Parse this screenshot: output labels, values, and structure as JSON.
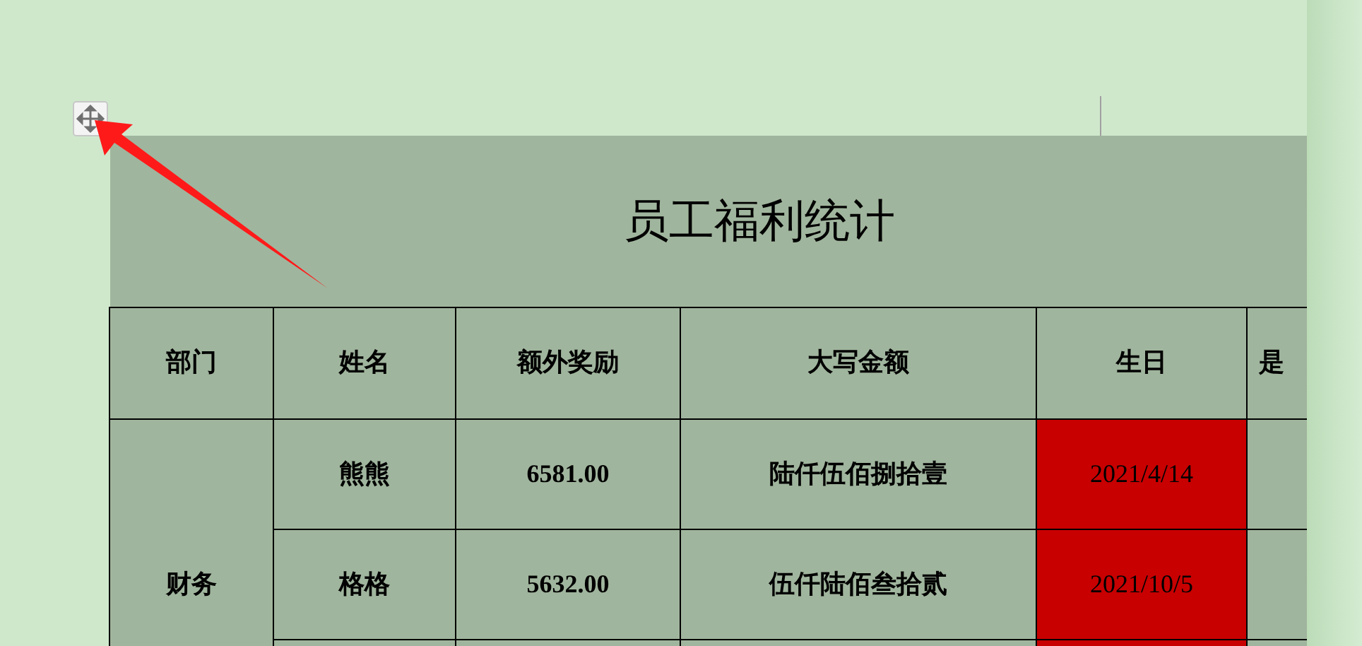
{
  "table": {
    "title": "员工福利统计",
    "columns": [
      "部门",
      "姓名",
      "额外奖励",
      "大写金额",
      "生日",
      "是"
    ],
    "groups": [
      {
        "department": "财务",
        "rows": [
          {
            "name": "熊熊",
            "bonus": "6581.00",
            "amount_in_words": "陆仟伍佰捌拾壹",
            "birthday": "2021/4/14",
            "highlighted": true
          },
          {
            "name": "格格",
            "bonus": "5632.00",
            "amount_in_words": "伍仟陆佰叁拾贰",
            "birthday": "2021/10/5",
            "highlighted": true
          },
          {
            "highlighted": true
          }
        ]
      }
    ]
  }
}
